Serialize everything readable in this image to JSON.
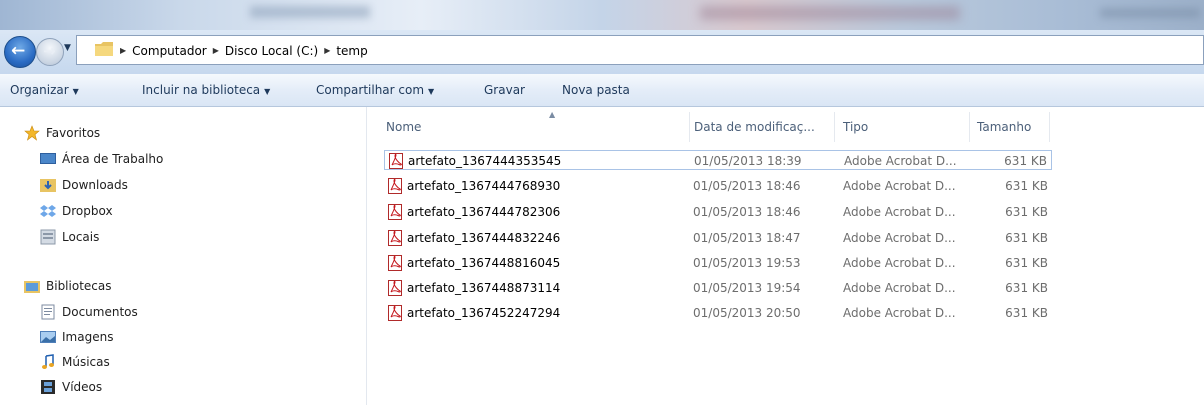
{
  "address": {
    "crumbs": [
      "Computador",
      "Disco Local (C:)",
      "temp"
    ]
  },
  "toolbar": {
    "organize": "Organizar",
    "include_library": "Incluir na biblioteca",
    "share_with": "Compartilhar com",
    "burn": "Gravar",
    "new_folder": "Nova pasta"
  },
  "nav": {
    "favorites_header": "Favoritos",
    "favorites": [
      "Área de Trabalho",
      "Downloads",
      "Dropbox",
      "Locais"
    ],
    "libraries_header": "Bibliotecas",
    "libraries": [
      "Documentos",
      "Imagens",
      "Músicas",
      "Vídeos"
    ]
  },
  "columns": {
    "name": "Nome",
    "date": "Data de modificaç...",
    "type": "Tipo",
    "size": "Tamanho"
  },
  "files": [
    {
      "name": "artefato_1367444353545",
      "date": "01/05/2013 18:39",
      "type": "Adobe Acrobat D...",
      "size": "631 KB"
    },
    {
      "name": "artefato_1367444768930",
      "date": "01/05/2013 18:46",
      "type": "Adobe Acrobat D...",
      "size": "631 KB"
    },
    {
      "name": "artefato_1367444782306",
      "date": "01/05/2013 18:46",
      "type": "Adobe Acrobat D...",
      "size": "631 KB"
    },
    {
      "name": "artefato_1367444832246",
      "date": "01/05/2013 18:47",
      "type": "Adobe Acrobat D...",
      "size": "631 KB"
    },
    {
      "name": "artefato_1367448816045",
      "date": "01/05/2013 19:53",
      "type": "Adobe Acrobat D...",
      "size": "631 KB"
    },
    {
      "name": "artefato_1367448873114",
      "date": "01/05/2013 19:54",
      "type": "Adobe Acrobat D...",
      "size": "631 KB"
    },
    {
      "name": "artefato_1367452247294",
      "date": "01/05/2013 20:50",
      "type": "Adobe Acrobat D...",
      "size": "631 KB"
    }
  ],
  "colors": {
    "accent": "#1e395b",
    "pdf_red": "#c4161c"
  }
}
